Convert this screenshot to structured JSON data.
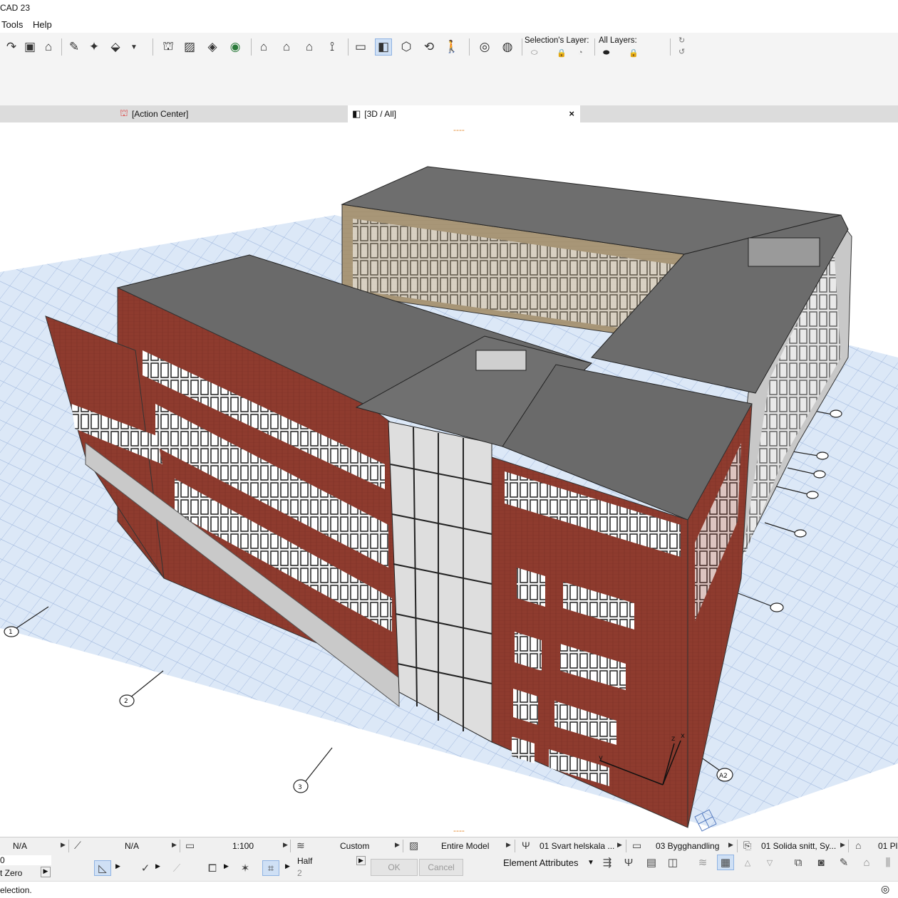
{
  "app": {
    "title": "CAD 23"
  },
  "menu": {
    "tools": "Tools",
    "help": "Help"
  },
  "toolbar": {
    "selection_layer_label": "Selection's Layer:",
    "all_layers_label": "All Layers:"
  },
  "tabs": [
    {
      "label": "[Action Center]",
      "icon": "action-center-icon"
    },
    {
      "label": "[3D / All]",
      "icon": "3d-window-icon",
      "close": "×"
    }
  ],
  "viewport": {
    "indicator_top": "----",
    "indicator_bottom": "----",
    "grid_bubbles": [
      "1",
      "2",
      "3",
      "A2"
    ],
    "axis_labels": {
      "z": "z",
      "x": "x",
      "y": "y"
    }
  },
  "statusbar": {
    "undo_value": "N/A",
    "redo_value": "N/A",
    "scale": "1:100",
    "layer_combination": "Custom",
    "model_view": "Entire Model",
    "pen_set": "01 Svart helskala ...",
    "renovation_filter": "03 Bygghandling",
    "graphic_override": "01 Solida snitt, Sy...",
    "dimension": "01 Pl"
  },
  "statusbar2": {
    "field_value": "0",
    "reference_label": "t Zero",
    "half_label": "Half",
    "half_value": "2",
    "ok": "OK",
    "cancel": "Cancel",
    "element_attributes": "Element Attributes"
  },
  "prompt": {
    "text": "election."
  }
}
